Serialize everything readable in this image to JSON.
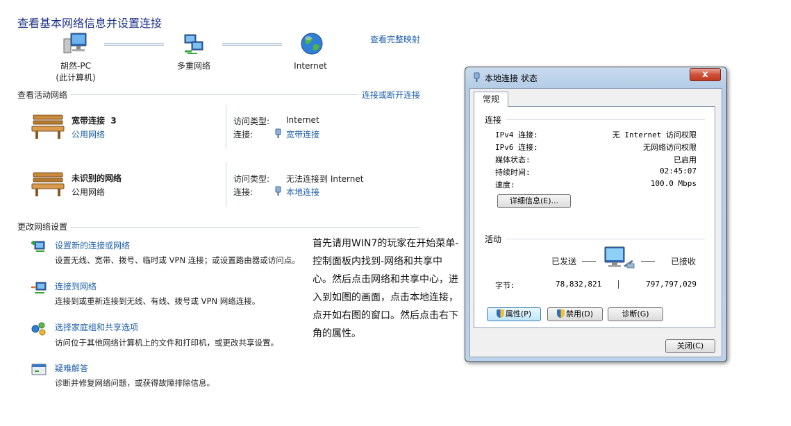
{
  "page": {
    "title": "查看基本网络信息并设置连接",
    "full_map_link": "查看完整映射"
  },
  "network_map": {
    "nodes": [
      {
        "label": "胡然-PC",
        "sublabel": "(此计算机)",
        "icon": "computer-icon"
      },
      {
        "label": "多重网络",
        "icon": "network-icon"
      },
      {
        "label": "Internet",
        "icon": "globe-icon"
      }
    ]
  },
  "active_networks": {
    "heading": "查看活动网络",
    "connect_link": "连接或断开连接",
    "access_type_label": "访问类型:",
    "connection_label": "连接:",
    "items": [
      {
        "name": "宽带连接  3",
        "category": "公用网络",
        "access_type": "Internet",
        "connection": "宽带连接",
        "icon": "bench-icon"
      },
      {
        "name": "未识别的网络",
        "category": "公用网络",
        "access_type": "无法连接到 Internet",
        "connection": "本地连接",
        "icon": "bench-icon"
      }
    ]
  },
  "change_settings": {
    "heading": "更改网络设置",
    "tasks": [
      {
        "title": "设置新的连接或网络",
        "desc": "设置无线、宽带、拨号、临时或 VPN 连接；或设置路由器或访问点。",
        "icon": "new-connection-icon"
      },
      {
        "title": "连接到网络",
        "desc": "连接到或重新连接到无线、有线、拨号或 VPN 网络连接。",
        "icon": "connect-network-icon"
      },
      {
        "title": "选择家庭组和共享选项",
        "desc": "访问位于其他网络计算机上的文件和打印机，或更改共享设置。",
        "icon": "homegroup-icon"
      },
      {
        "title": "疑难解答",
        "desc": "诊断并修复网络问题，或获得故障排除信息。",
        "icon": "troubleshoot-icon"
      }
    ]
  },
  "instruction_text": "首先请用WIN7的玩家在开始菜单-控制面板内找到-网络和共享中心。然后点击网络和共享中心，进入到如图的画面，点击本地连接，点开如右图的窗口。然后点击右下角的属性。",
  "dialog": {
    "title": "本地连接 状态",
    "close_glyph": "x",
    "tab": "常规",
    "connection": {
      "heading": "连接",
      "rows": [
        {
          "label": "IPv4 连接:",
          "value": "无 Internet 访问权限"
        },
        {
          "label": "IPv6 连接:",
          "value": "无网络访问权限"
        },
        {
          "label": "媒体状态:",
          "value": "已启用"
        },
        {
          "label": "持续时间:",
          "value": "02:45:07"
        },
        {
          "label": "速度:",
          "value": "100.0 Mbps"
        }
      ],
      "details_button": "详细信息(E)..."
    },
    "activity": {
      "heading": "活动",
      "sent_label": "已发送",
      "received_label": "已接收",
      "bytes_label": "字节:",
      "bytes_sent": "78,832,821",
      "bytes_received": "797,797,029"
    },
    "buttons": {
      "properties": "属性(P)",
      "disable": "禁用(D)",
      "diagnose": "诊断(G)",
      "close": "关闭(C)"
    }
  }
}
